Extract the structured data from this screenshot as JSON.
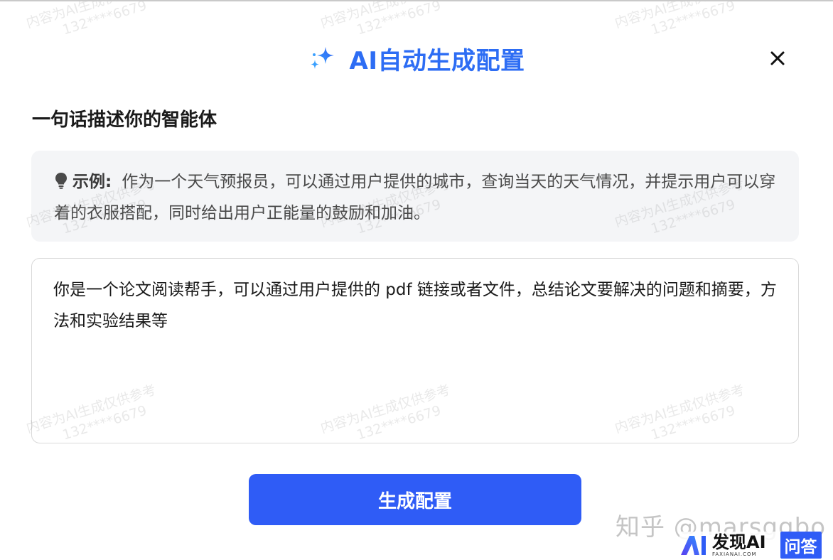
{
  "dialog": {
    "title": "AI自动生成配置",
    "icon": "sparkle-icon",
    "close_icon": "close-icon"
  },
  "section": {
    "label": "一句话描述你的智能体"
  },
  "example": {
    "icon": "lightbulb-icon",
    "label": "示例:",
    "text": "作为一个天气预报员，可以通过用户提供的城市，查询当天的天气情况，并提示用户可以穿着的衣服搭配，同时给出用户正能量的鼓励和加油。"
  },
  "prompt": {
    "value": "你是一个论文阅读帮手，可以通过用户提供的 pdf 链接或者文件，总结论文要解决的问题和摘要，方法和实验结果等"
  },
  "actions": {
    "generate_label": "生成配置"
  },
  "watermark": {
    "line1": "内容为AI生成仅供参考",
    "line2": "132****6679"
  },
  "brand": {
    "zhihu": "知乎 @marsggbo",
    "faxian_name": "发现AI",
    "faxian_sub": "FAXIANAI.COM",
    "wenda": "问答"
  },
  "colors": {
    "accent": "#2d6df4",
    "button": "#2f5cf6",
    "example_bg": "#f4f5f7"
  }
}
